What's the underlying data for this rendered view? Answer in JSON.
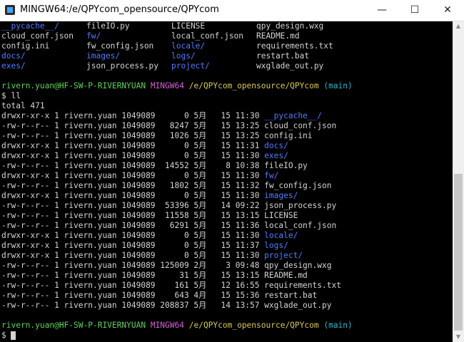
{
  "window": {
    "title": "MINGW64:/e/QPYcom_opensource/QPYcom",
    "controls": {
      "minimize": "—",
      "maximize": "☐",
      "close": "✕"
    }
  },
  "colors": {
    "background": "#000000",
    "text": "#d3d3d3",
    "directory": "#4f7bff",
    "prompt_user": "#5bd25b",
    "prompt_host": "#d55fd5",
    "prompt_path": "#d8c94e",
    "prompt_branch": "#2cb7c7"
  },
  "terminal": {
    "grid_rows": [
      [
        {
          "text": "__pycache__/",
          "type": "dir"
        },
        {
          "text": "fileIO.py",
          "type": "file"
        },
        {
          "text": "LICENSE",
          "type": "file"
        },
        {
          "text": "qpy_design.wxg",
          "type": "file"
        }
      ],
      [
        {
          "text": "cloud_conf.json",
          "type": "file"
        },
        {
          "text": "fw/",
          "type": "dir"
        },
        {
          "text": "local_conf.json",
          "type": "file"
        },
        {
          "text": "README.md",
          "type": "file"
        }
      ],
      [
        {
          "text": "config.ini",
          "type": "file"
        },
        {
          "text": "fw_config.json",
          "type": "file"
        },
        {
          "text": "locale/",
          "type": "dir"
        },
        {
          "text": "requirements.txt",
          "type": "file"
        }
      ],
      [
        {
          "text": "docs/",
          "type": "dir"
        },
        {
          "text": "images/",
          "type": "dir"
        },
        {
          "text": "logs/",
          "type": "dir"
        },
        {
          "text": "restart.bat",
          "type": "file"
        }
      ],
      [
        {
          "text": "exes/",
          "type": "dir"
        },
        {
          "text": "json_process.py",
          "type": "file"
        },
        {
          "text": "project/",
          "type": "dir"
        },
        {
          "text": "wxglade_out.py",
          "type": "file"
        }
      ]
    ],
    "prompt1": {
      "user_host": "rivern.yuan@HF-SW-P-RIVERNYUAN",
      "shell": "MINGW64",
      "path": "/e/QPYcom_opensource/QPYcom",
      "branch": "(main)"
    },
    "command": "$ ll",
    "total": "total 471",
    "listing": [
      {
        "prefix": "drwxr-xr-x 1 rivern.yuan 1049089      0 5月   15 11:30 ",
        "name": "__pycache__/",
        "type": "dir"
      },
      {
        "prefix": "-rw-r--r-- 1 rivern.yuan 1049089   8247 5月   15 13:25 ",
        "name": "cloud_conf.json",
        "type": "file"
      },
      {
        "prefix": "-rw-r--r-- 1 rivern.yuan 1049089   1026 5月   15 13:25 ",
        "name": "config.ini",
        "type": "file"
      },
      {
        "prefix": "drwxr-xr-x 1 rivern.yuan 1049089      0 5月   15 11:31 ",
        "name": "docs/",
        "type": "dir"
      },
      {
        "prefix": "drwxr-xr-x 1 rivern.yuan 1049089      0 5月   15 11:30 ",
        "name": "exes/",
        "type": "dir"
      },
      {
        "prefix": "-rw-r--r-- 1 rivern.yuan 1049089  14552 5月    8 10:38 ",
        "name": "fileIO.py",
        "type": "file"
      },
      {
        "prefix": "drwxr-xr-x 1 rivern.yuan 1049089      0 5月   15 11:30 ",
        "name": "fw/",
        "type": "dir"
      },
      {
        "prefix": "-rw-r--r-- 1 rivern.yuan 1049089   1802 5月   15 11:32 ",
        "name": "fw_config.json",
        "type": "file"
      },
      {
        "prefix": "drwxr-xr-x 1 rivern.yuan 1049089      0 5月   15 11:30 ",
        "name": "images/",
        "type": "dir"
      },
      {
        "prefix": "-rw-r--r-- 1 rivern.yuan 1049089  53396 5月   14 09:22 ",
        "name": "json_process.py",
        "type": "file"
      },
      {
        "prefix": "-rw-r--r-- 1 rivern.yuan 1049089  11558 5月   15 13:15 ",
        "name": "LICENSE",
        "type": "file"
      },
      {
        "prefix": "-rw-r--r-- 1 rivern.yuan 1049089   6291 5月   15 11:36 ",
        "name": "local_conf.json",
        "type": "file"
      },
      {
        "prefix": "drwxr-xr-x 1 rivern.yuan 1049089      0 5月   15 11:30 ",
        "name": "locale/",
        "type": "dir"
      },
      {
        "prefix": "drwxr-xr-x 1 rivern.yuan 1049089      0 5月   15 11:37 ",
        "name": "logs/",
        "type": "dir"
      },
      {
        "prefix": "drwxr-xr-x 1 rivern.yuan 1049089      0 5月   15 11:30 ",
        "name": "project/",
        "type": "dir"
      },
      {
        "prefix": "-rw-r--r-- 1 rivern.yuan 1049089 125009 2月    3 09:48 ",
        "name": "qpy_design.wxg",
        "type": "file"
      },
      {
        "prefix": "-rw-r--r-- 1 rivern.yuan 1049089     31 5月   15 13:15 ",
        "name": "README.md",
        "type": "file"
      },
      {
        "prefix": "-rw-r--r-- 1 rivern.yuan 1049089    161 5月   12 16:55 ",
        "name": "requirements.txt",
        "type": "file"
      },
      {
        "prefix": "-rw-r--r-- 1 rivern.yuan 1049089    643 4月   15 15:36 ",
        "name": "restart.bat",
        "type": "file"
      },
      {
        "prefix": "-rw-r--r-- 1 rivern.yuan 1049089 208837 5月   14 13:57 ",
        "name": "wxglade_out.py",
        "type": "file"
      }
    ],
    "prompt2": {
      "user_host": "rivern.yuan@HF-SW-P-RIVERNYUAN",
      "shell": "MINGW64",
      "path": "/e/QPYcom_opensource/QPYcom",
      "branch": "(main)"
    },
    "input_prompt": "$ "
  }
}
